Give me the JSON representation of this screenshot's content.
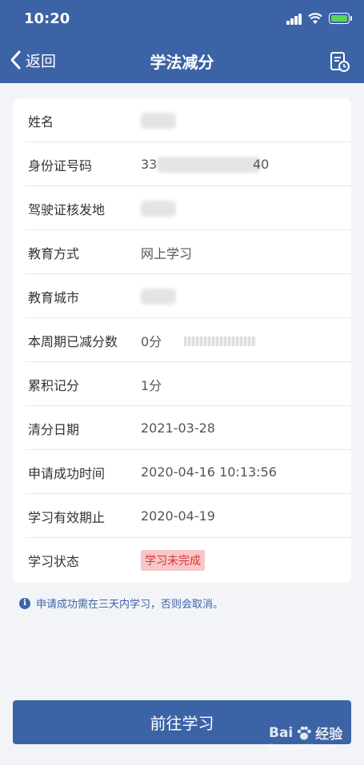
{
  "status_bar": {
    "time": "10:20"
  },
  "nav": {
    "back_label": "返回",
    "title": "学法减分"
  },
  "rows": [
    {
      "label": "姓名",
      "value": ""
    },
    {
      "label": "身份证号码",
      "value": "33",
      "value_end": "40"
    },
    {
      "label": "驾驶证核发地",
      "value": ""
    },
    {
      "label": "教育方式",
      "value": "网上学习"
    },
    {
      "label": "教育城市",
      "value": ""
    },
    {
      "label": "本周期已减分数",
      "value": "0分"
    },
    {
      "label": "累积记分",
      "value": "1分"
    },
    {
      "label": "清分日期",
      "value": "2021-03-28"
    },
    {
      "label": "申请成功时间",
      "value": "2020-04-16 10:13:56"
    },
    {
      "label": "学习有效期止",
      "value": "2020-04-19"
    },
    {
      "label": "学习状态",
      "value": "学习未完成"
    }
  ],
  "notice": "申请成功需在三天内学习，否则会取消。",
  "button": {
    "label": "前往学习"
  },
  "watermark": {
    "text_bai": "Bai",
    "text_jingyan": "经验",
    "sub": "jingyan.baidu.com"
  },
  "colors": {
    "brand": "#3c63a6",
    "status_bg": "#f7c6c6",
    "status_text": "#d9363e"
  }
}
